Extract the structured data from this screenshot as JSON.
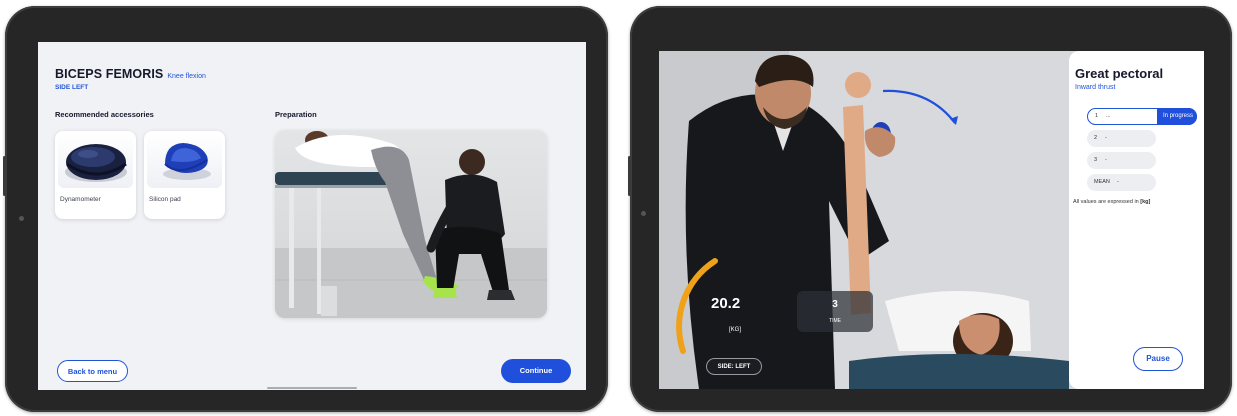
{
  "left_screen": {
    "exercise_title": "BICEPS FEMORIS",
    "exercise_subtitle": "Knee flexion",
    "side": "SIDE LEFT",
    "accessories_heading": "Recommended accessories",
    "preparation_heading": "Preparation",
    "accessories": [
      {
        "label": "Dynamometer",
        "icon": "dynamometer-icon"
      },
      {
        "label": "Silicon pad",
        "icon": "silicon-pad-icon"
      }
    ],
    "back_button": "Back to menu",
    "continue_button": "Continue"
  },
  "right_screen": {
    "exercise_title": "Great pectoral",
    "exercise_subtitle": "Inward thrust",
    "reps": [
      {
        "num": "1",
        "value": "...",
        "status": "In progress"
      },
      {
        "num": "2",
        "value": "-"
      },
      {
        "num": "3",
        "value": "-"
      }
    ],
    "mean_label": "MEAN",
    "mean_value": "-",
    "units_text": "All values are expressed in",
    "units_value": "[kg]",
    "force_value": "20.2",
    "force_unit": "[KG]",
    "rep_count": "3",
    "rep_label": "TIME",
    "side_badge": "SIDE: LEFT",
    "pause_button": "Pause"
  },
  "colors": {
    "accent": "#1f4fdb",
    "device_frame": "#262626",
    "screen_bg": "#f0f2f6",
    "gauge": "#f0a11a"
  }
}
